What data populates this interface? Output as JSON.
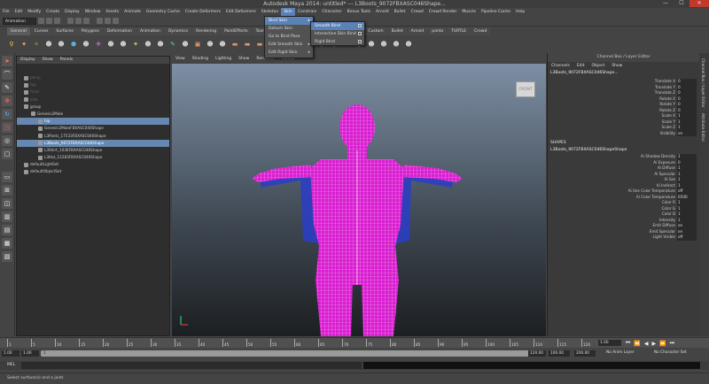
{
  "window": {
    "title": "Autodesk Maya 2014: untitled*   ---   L3Boots_9072FBXASC046Shape..."
  },
  "menubar": [
    "File",
    "Edit",
    "Modify",
    "Create",
    "Display",
    "Window",
    "Assets",
    "Animate",
    "Geometry Cache",
    "Create Deformers",
    "Edit Deformers",
    "Skeleton",
    "Skin",
    "Constrain",
    "Character",
    "Bonus Tools",
    "Arnold",
    "Bullet",
    "Crowd",
    "Crowd Render",
    "Muscle",
    "Pipeline Cache",
    "Help"
  ],
  "statusline": {
    "mode": "Animation"
  },
  "shelf_tabs": [
    "General",
    "Curves",
    "Surfaces",
    "Polygons",
    "Deformation",
    "Animation",
    "Dynamics",
    "Rendering",
    "PaintEffects",
    "Toon",
    "Muscle",
    "Fluids",
    "Fur",
    "nHair",
    "nCloth",
    "Custom",
    "Bullet",
    "Arnold",
    "panto",
    "TURTLE",
    "Crowd"
  ],
  "skin_menu": {
    "items": [
      {
        "label": "Bind Skin",
        "has_sub": true
      },
      {
        "label": "Detach Skin",
        "has_sub": false
      },
      {
        "label": "Go to Bind Pose",
        "has_sub": false
      },
      {
        "label": "Edit Smooth Skin",
        "has_sub": true
      },
      {
        "label": "Edit Rigid Skin",
        "has_sub": true
      }
    ]
  },
  "bind_menu": {
    "items": [
      {
        "label": "Smooth Bind"
      },
      {
        "label": "Interactive Skin Bind"
      },
      {
        "label": "Rigid Bind"
      }
    ]
  },
  "outliner": {
    "menu": [
      "Display",
      "Show",
      "Panels"
    ],
    "rows": [
      {
        "label": "persp",
        "indent": 1,
        "sel": false,
        "dim": true
      },
      {
        "label": "top",
        "indent": 1,
        "sel": false,
        "dim": true
      },
      {
        "label": "front",
        "indent": 1,
        "sel": false,
        "dim": true
      },
      {
        "label": "side",
        "indent": 1,
        "sel": false,
        "dim": true
      },
      {
        "label": "group",
        "indent": 1,
        "sel": false,
        "dim": false
      },
      {
        "label": "Genesis2Male",
        "indent": 2,
        "sel": false,
        "dim": false
      },
      {
        "label": "hip",
        "indent": 3,
        "sel": true,
        "dim": false
      },
      {
        "label": "Genesis2MaleFBXASC046Shape",
        "indent": 3,
        "sel": false,
        "dim": false
      },
      {
        "label": "L3Pants_17533FBXASC046Shape",
        "indent": 3,
        "sel": false,
        "dim": false
      },
      {
        "label": "L3Boots_9072FBXASC046Shape",
        "indent": 3,
        "sel": true,
        "dim": false
      },
      {
        "label": "L3Shirt_1036FBXASC046Shape",
        "indent": 3,
        "sel": false,
        "dim": false
      },
      {
        "label": "L3Hat_12283FBXASC046Shape",
        "indent": 3,
        "sel": false,
        "dim": false
      },
      {
        "label": "defaultLightSet",
        "indent": 1,
        "sel": false,
        "dim": false
      },
      {
        "label": "defaultObjectSet",
        "indent": 1,
        "sel": false,
        "dim": false
      }
    ]
  },
  "viewport": {
    "menu": [
      "View",
      "Shading",
      "Lighting",
      "Show",
      "Renderer",
      "Panels"
    ],
    "viewcube_label": "FRONT"
  },
  "channelbox": {
    "header": "Channel Box / Layer Editor",
    "tabs": [
      "Channels",
      "Edit",
      "Object",
      "Show"
    ],
    "object_name": "L3Boots_9072FBXASC046Shape...",
    "transform_attrs": [
      {
        "name": "Translate X",
        "value": "0"
      },
      {
        "name": "Translate Y",
        "value": "0"
      },
      {
        "name": "Translate Z",
        "value": "0"
      },
      {
        "name": "Rotate X",
        "value": "0"
      },
      {
        "name": "Rotate Y",
        "value": "0"
      },
      {
        "name": "Rotate Z",
        "value": "0"
      },
      {
        "name": "Scale X",
        "value": "1"
      },
      {
        "name": "Scale Y",
        "value": "1"
      },
      {
        "name": "Scale Z",
        "value": "1"
      },
      {
        "name": "Visibility",
        "value": "on"
      }
    ],
    "shapes_label": "SHAPES",
    "shape_name": "L3Boots_9072FBXASC046ShapeShape",
    "shape_attrs": [
      {
        "name": "Ai Shadow Density",
        "value": "1"
      },
      {
        "name": "Ai Exposure",
        "value": "0"
      },
      {
        "name": "Ai Diffuse",
        "value": "1"
      },
      {
        "name": "Ai Specular",
        "value": "1"
      },
      {
        "name": "Ai Sss",
        "value": "1"
      },
      {
        "name": "Ai Indirect",
        "value": "1"
      },
      {
        "name": "Ai Use Color Temperature",
        "value": "off"
      },
      {
        "name": "Ai Color Temperature",
        "value": "6500"
      },
      {
        "name": "Color R",
        "value": "1"
      },
      {
        "name": "Color G",
        "value": "1"
      },
      {
        "name": "Color B",
        "value": "1"
      },
      {
        "name": "Intensity",
        "value": "1"
      },
      {
        "name": "Emit Diffuse",
        "value": "on"
      },
      {
        "name": "Emit Specular",
        "value": "on"
      },
      {
        "name": "Light Visible",
        "value": "off"
      }
    ],
    "side_tabs": [
      "Channel Box / Layer Editor",
      "Attribute Editor"
    ]
  },
  "timeline": {
    "ticks": [
      "1",
      "5",
      "10",
      "15",
      "20",
      "25",
      "30",
      "35",
      "40",
      "45",
      "50",
      "55",
      "60",
      "65",
      "70",
      "75",
      "80",
      "85",
      "90",
      "95",
      "100",
      "105",
      "110",
      "115",
      "120"
    ],
    "current_frame": "1.00"
  },
  "range": {
    "start": "1.00",
    "inner_start": "1.00",
    "start_marker": "1",
    "end_marker": "120",
    "end": "120.00",
    "inner_end": "100.00",
    "max_end": "200.00",
    "anim_layer": "No Anim Layer",
    "char_set": "No Character Set"
  },
  "mel": {
    "label": "MEL"
  },
  "help": {
    "text": "Select surface(s) and a joint."
  },
  "colors": {
    "mesh": "#e62bd6",
    "highlight": "#5b82b7",
    "selection": "#6688b0"
  }
}
